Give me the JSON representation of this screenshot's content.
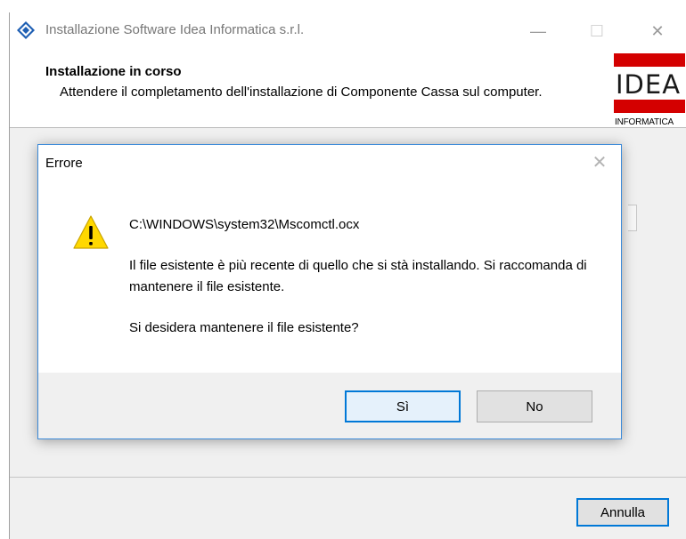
{
  "window": {
    "title": "Installazione Software Idea Informatica s.r.l.",
    "minimize_glyph": "—",
    "maximize_glyph": "☐",
    "close_glyph": "✕"
  },
  "header": {
    "title": "Installazione in corso",
    "subtitle": "Attendere il completamento dell'installazione di Componente Cassa sul computer."
  },
  "logo": {
    "line1": "IDEA",
    "line2": "INFORMATICA",
    "brand_color": "#d40000"
  },
  "footer": {
    "cancel_label": "Annulla"
  },
  "dialog": {
    "title": "Errore",
    "close_glyph": "✕",
    "icon": "warning-icon",
    "path": "C:\\WINDOWS\\system32\\Mscomctl.ocx",
    "message": "Il file esistente è più recente di quello che si stà installando. Si raccomanda di mantenere il file esistente.",
    "question": "Si desidera mantenere il file esistente?",
    "yes_label": "Sì",
    "no_label": "No"
  },
  "colors": {
    "accent": "#0078d7",
    "warning_fill": "#ffd800"
  }
}
